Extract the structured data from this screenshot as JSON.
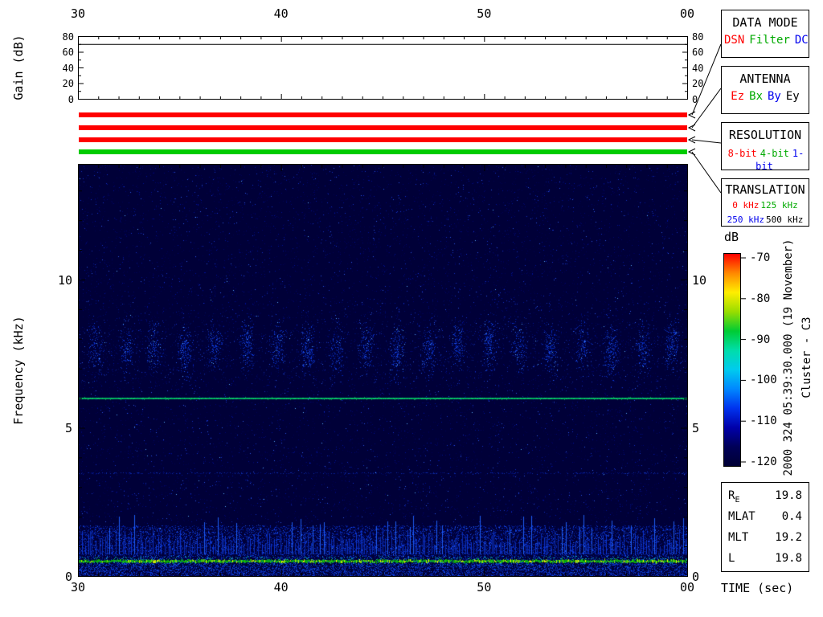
{
  "panel": {
    "gain_ylabel": "Gain (dB)",
    "freq_ylabel": "Frequency (kHz)",
    "time_xlabel": "TIME (sec)",
    "db_label": "dB"
  },
  "axes": {
    "time_ticks": [
      "30",
      "40",
      "50",
      "00"
    ],
    "gain_ticks": [
      "80",
      "60",
      "40",
      "20",
      "0"
    ],
    "freq_ticks": [
      "10",
      "5",
      "0"
    ],
    "colorbar_ticks": [
      "-70",
      "-80",
      "-90",
      "-100",
      "-110",
      "-120"
    ]
  },
  "mode_bars": [
    {
      "name": "data-mode-bar",
      "color": "#ff0000"
    },
    {
      "name": "antenna-bar",
      "color": "#ff0000"
    },
    {
      "name": "resolution-bar",
      "color": "#ff0000"
    },
    {
      "name": "translation-bar",
      "color": "#00cc00"
    }
  ],
  "legends": [
    {
      "title": "DATA MODE",
      "items": [
        {
          "label": "DSN",
          "color": "#ff0000"
        },
        {
          "label": "Filter",
          "color": "#00aa00"
        },
        {
          "label": "DC",
          "color": "#0000ee"
        }
      ]
    },
    {
      "title": "ANTENNA",
      "items": [
        {
          "label": "Ez",
          "color": "#ff0000"
        },
        {
          "label": "Bx",
          "color": "#00aa00"
        },
        {
          "label": "By",
          "color": "#0000ee"
        },
        {
          "label": "Ey",
          "color": "#000000"
        }
      ]
    },
    {
      "title": "RESOLUTION",
      "items": [
        {
          "label": "8-bit",
          "color": "#ff0000"
        },
        {
          "label": "4-bit",
          "color": "#00aa00"
        },
        {
          "label": "1-bit",
          "color": "#0000ee"
        }
      ]
    },
    {
      "title": "TRANSLATION",
      "items": [
        {
          "label": "0 kHz",
          "color": "#ff0000"
        },
        {
          "label": "125 kHz",
          "color": "#00aa00"
        },
        {
          "label": "250 kHz",
          "color": "#0000ee"
        },
        {
          "label": "500 kHz",
          "color": "#000000"
        }
      ]
    }
  ],
  "colorbar": {
    "label": "dB",
    "ticks": [
      "-70",
      "-80",
      "-90",
      "-100",
      "-110",
      "-120"
    ],
    "gradient": [
      "#ff0000",
      "#ff8800",
      "#ffee00",
      "#99dd00",
      "#00cc33",
      "#00ddaa",
      "#00cbee",
      "#0088ff",
      "#0033ee",
      "#0000aa",
      "#000058",
      "#000034"
    ]
  },
  "side_text": {
    "datetime": "2000 324 05:39:30.000 (19 November)",
    "spacecraft": "Cluster - C3"
  },
  "info": {
    "rows": [
      {
        "label": "R",
        "sub": "E",
        "value": "19.8"
      },
      {
        "label": "MLAT",
        "value": "0.4"
      },
      {
        "label": "MLT",
        "value": "19.2"
      },
      {
        "label": "L",
        "value": "19.8"
      }
    ]
  },
  "chart_data": [
    {
      "type": "line",
      "title": "Receiver gain",
      "ylabel": "Gain (dB)",
      "xlabel": "TIME (sec)",
      "ylim": [
        0,
        80
      ],
      "yticks": [
        0,
        20,
        40,
        60,
        80
      ],
      "x_start_sec": 30,
      "x_end_sec": 60,
      "xticklabels": [
        "30",
        "40",
        "50",
        "00"
      ],
      "series": [
        {
          "name": "Gain",
          "values": [
            70,
            70
          ],
          "color": "#000000"
        }
      ]
    },
    {
      "type": "heatmap",
      "title": "Cluster WBD wideband spectrogram",
      "xlabel": "TIME (sec)",
      "ylabel": "Frequency (kHz)",
      "x_start_sec": 30,
      "x_end_sec": 60,
      "xticklabels": [
        "30",
        "40",
        "50",
        "00"
      ],
      "ylim": [
        0,
        13.9
      ],
      "yticks": [
        0,
        5,
        10
      ],
      "zlabel": "dB",
      "zlim": [
        -120,
        -70
      ],
      "colorbar_ticks": [
        -70,
        -80,
        -90,
        -100,
        -110,
        -120
      ],
      "background_db": -120,
      "background_color": "#000038",
      "features": [
        {
          "kind": "narrowband_tone",
          "freq_khz": 6.0,
          "approx_db": -95,
          "description": "continuous green narrowband emission line across the whole interval"
        },
        {
          "kind": "periodic_bursts",
          "freq_center_khz": 7.7,
          "freq_halfwidth_khz": 0.9,
          "period_sec": 1.5,
          "approx_db": -110,
          "description": "regularly spaced faint blue emission patches"
        },
        {
          "kind": "broadband_low_band",
          "freq_range_khz": [
            0,
            1.7
          ],
          "peak_freq_khz": 0.5,
          "approx_db": -88,
          "description": "intense low-frequency band with green/yellow peak near 0.5 kHz and blue vertical striations up to ~1.6 kHz"
        },
        {
          "kind": "weak_tone",
          "freq_khz": 3.5,
          "approx_db": -116,
          "description": "very faint dotted horizontal line"
        }
      ]
    }
  ]
}
